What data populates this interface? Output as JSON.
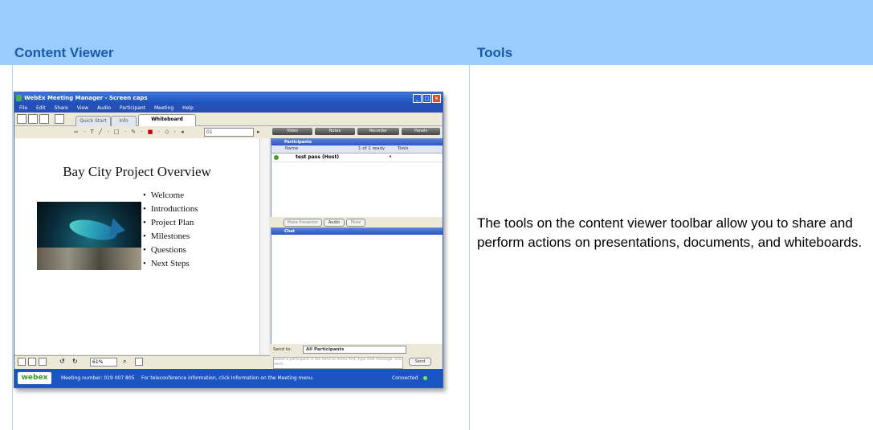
{
  "header": {
    "col1": "Content Viewer",
    "col2": "Tools"
  },
  "description": "The tools on the content viewer toolbar allow you to share and perform actions on presentations, documents, and whiteboards.",
  "screenshot": {
    "window_title": "WebEx Meeting Manager - Screen caps",
    "menu": [
      "File",
      "Edit",
      "Share",
      "View",
      "Audio",
      "Participant",
      "Meeting",
      "Help"
    ],
    "tabs": [
      "Quick Start",
      "Info",
      "Whiteboard"
    ],
    "page_field": "01",
    "right_buttons": [
      "Video",
      "Notes",
      "Recorder",
      "Panels"
    ],
    "slide": {
      "title": "Bay City Project Overview",
      "bullets": [
        "Welcome",
        "Introductions",
        "Project Plan",
        "Milestones",
        "Questions",
        "Next Steps"
      ]
    },
    "zoom": "61%",
    "participants": {
      "header": "Participants",
      "col_name": "Name",
      "col_ready": "1 of 1 ready",
      "col_tools": "Tools",
      "rows": [
        {
          "name": "test pass (Host)"
        }
      ]
    },
    "participant_buttons": [
      "Make Presenter",
      "Audio",
      "Mute"
    ],
    "chat": {
      "header": "Chat",
      "send_to_label": "Send to:",
      "send_to_value": "All Participants",
      "placeholder": "Select a participant in the Send to menu first, type chat message, and send...",
      "send_label": "Send"
    },
    "status": {
      "logo": "webex",
      "meeting": "Meeting number: 019 007 805",
      "info": "For teleconference information, click Information on the Meeting menu.",
      "connection": "Connected"
    }
  }
}
